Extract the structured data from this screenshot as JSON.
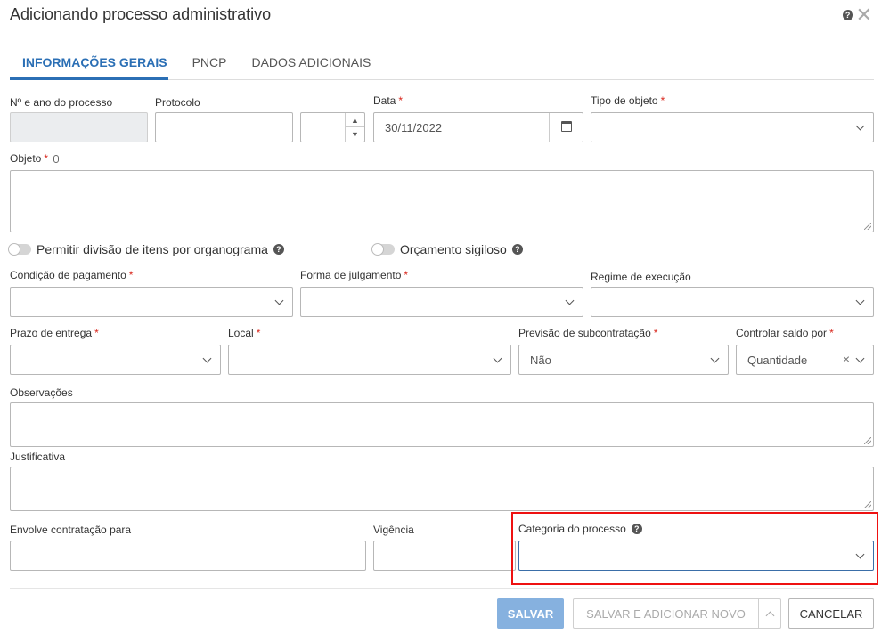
{
  "dialog": {
    "title": "Adicionando processo administrativo",
    "help_glyph": "?",
    "close_glyph": "✕"
  },
  "tabs": [
    {
      "label": "INFORMAÇÕES GERAIS",
      "active": true
    },
    {
      "label": "PNCP",
      "active": false
    },
    {
      "label": "DADOS ADICIONAIS",
      "active": false
    }
  ],
  "fields": {
    "numero_ano": {
      "label": "Nº e ano do processo",
      "value": ""
    },
    "protocolo": {
      "label": "Protocolo",
      "value": ""
    },
    "protocolo_ano": {
      "value": ""
    },
    "data": {
      "label": "Data",
      "required": "*",
      "value": "30/11/2022"
    },
    "tipo_objeto": {
      "label": "Tipo de objeto",
      "required": "*",
      "value": ""
    },
    "objeto": {
      "label": "Objeto",
      "required": "*",
      "value": ""
    },
    "condicao_pagamento": {
      "label": "Condição de pagamento",
      "required": "*",
      "value": ""
    },
    "forma_julgamento": {
      "label": "Forma de julgamento",
      "required": "*",
      "value": ""
    },
    "regime_execucao": {
      "label": "Regime de execução",
      "value": ""
    },
    "prazo_entrega": {
      "label": "Prazo de entrega",
      "required": "*",
      "value": ""
    },
    "local": {
      "label": "Local",
      "required": "*",
      "value": ""
    },
    "previsao_subcontratacao": {
      "label": "Previsão de subcontratação",
      "required": "*",
      "value": "Não"
    },
    "controlar_saldo": {
      "label": "Controlar saldo por",
      "required": "*",
      "value": "Quantidade",
      "clear_glyph": "×"
    },
    "observacoes": {
      "label": "Observações",
      "value": ""
    },
    "justificativa": {
      "label": "Justificativa",
      "value": ""
    },
    "envolve_contratacao": {
      "label": "Envolve contratação para",
      "value": ""
    },
    "vigencia": {
      "label": "Vigência",
      "value": ""
    },
    "categoria_processo": {
      "label": "Categoria do processo",
      "value": ""
    }
  },
  "toggles": {
    "divisao_itens": {
      "label": "Permitir divisão de itens por organograma",
      "on": false
    },
    "orcamento_sigiloso": {
      "label": "Orçamento sigiloso",
      "on": false
    }
  },
  "buttons": {
    "salvar": "SALVAR",
    "salvar_novo": "SALVAR E ADICIONAR NOVO",
    "cancelar": "CANCELAR"
  },
  "colors": {
    "accent": "#2b6fb5",
    "required": "#d9261c",
    "highlight_box": "#ee1111",
    "primary_btn": "#86b1df"
  }
}
